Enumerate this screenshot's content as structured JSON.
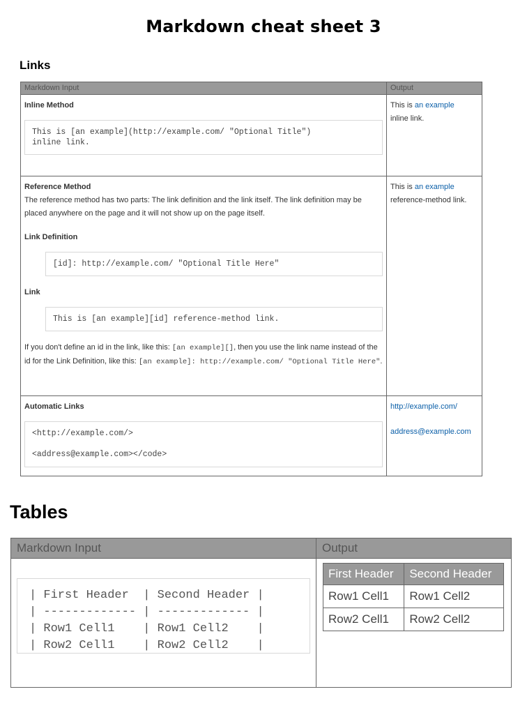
{
  "page": {
    "title": "Markdown cheat sheet 3"
  },
  "links": {
    "section_title": "Links",
    "header": {
      "input": "Markdown Input",
      "output": "Output"
    },
    "inline": {
      "title": "Inline Method",
      "code_line1": "This is [an example](http://example.com/ \"Optional Title\")",
      "code_line2": "inline link.",
      "out_pre": "This is ",
      "out_link": "an example",
      "out_post": "inline link."
    },
    "reference": {
      "title": "Reference Method",
      "desc": "The reference method has two parts: The link definition and the link itself. The link definition may be placed anywhere on the page and it will not show up on the page itself.",
      "def_title": "Link Definition",
      "def_code": "[id]: http://example.com/ \"Optional Title Here\"",
      "link_title": "Link",
      "link_code": "This is [an example][id] reference-method link.",
      "note_a": "If you don't define an id in the link, like this: ",
      "note_code_a": "[an example][]",
      "note_b": ", then you use the link name instead of the id for the Link Definition, like this: ",
      "note_code_b": "[an example]: http://example.com/ \"Optional Title Here\"",
      "note_c": ".",
      "out_pre": "This is ",
      "out_link": "an example",
      "out_post": "reference-method link."
    },
    "automatic": {
      "title": "Automatic Links",
      "code_line1": "<http://example.com/>",
      "code_line2": "<address@example.com></code>",
      "out_url": "http://example.com/",
      "out_email": "address@example.com"
    }
  },
  "tables": {
    "section_title": "Tables",
    "header": {
      "input": "Markdown Input",
      "output": "Output"
    },
    "code_lines": [
      "| First Header  | Second Header |",
      "| ------------- | ------------- |",
      "| Row1 Cell1    | Row1 Cell2    |",
      "| Row2 Cell1    | Row2 Cell2    |"
    ],
    "output": {
      "headers": [
        "First Header",
        "Second Header"
      ],
      "rows": [
        [
          "Row1 Cell1",
          "Row1 Cell2"
        ],
        [
          "Row2 Cell1",
          "Row2 Cell2"
        ]
      ]
    }
  },
  "colors": {
    "header_bg": "#999999",
    "link": "#0b5fa8",
    "border": "#666666"
  }
}
